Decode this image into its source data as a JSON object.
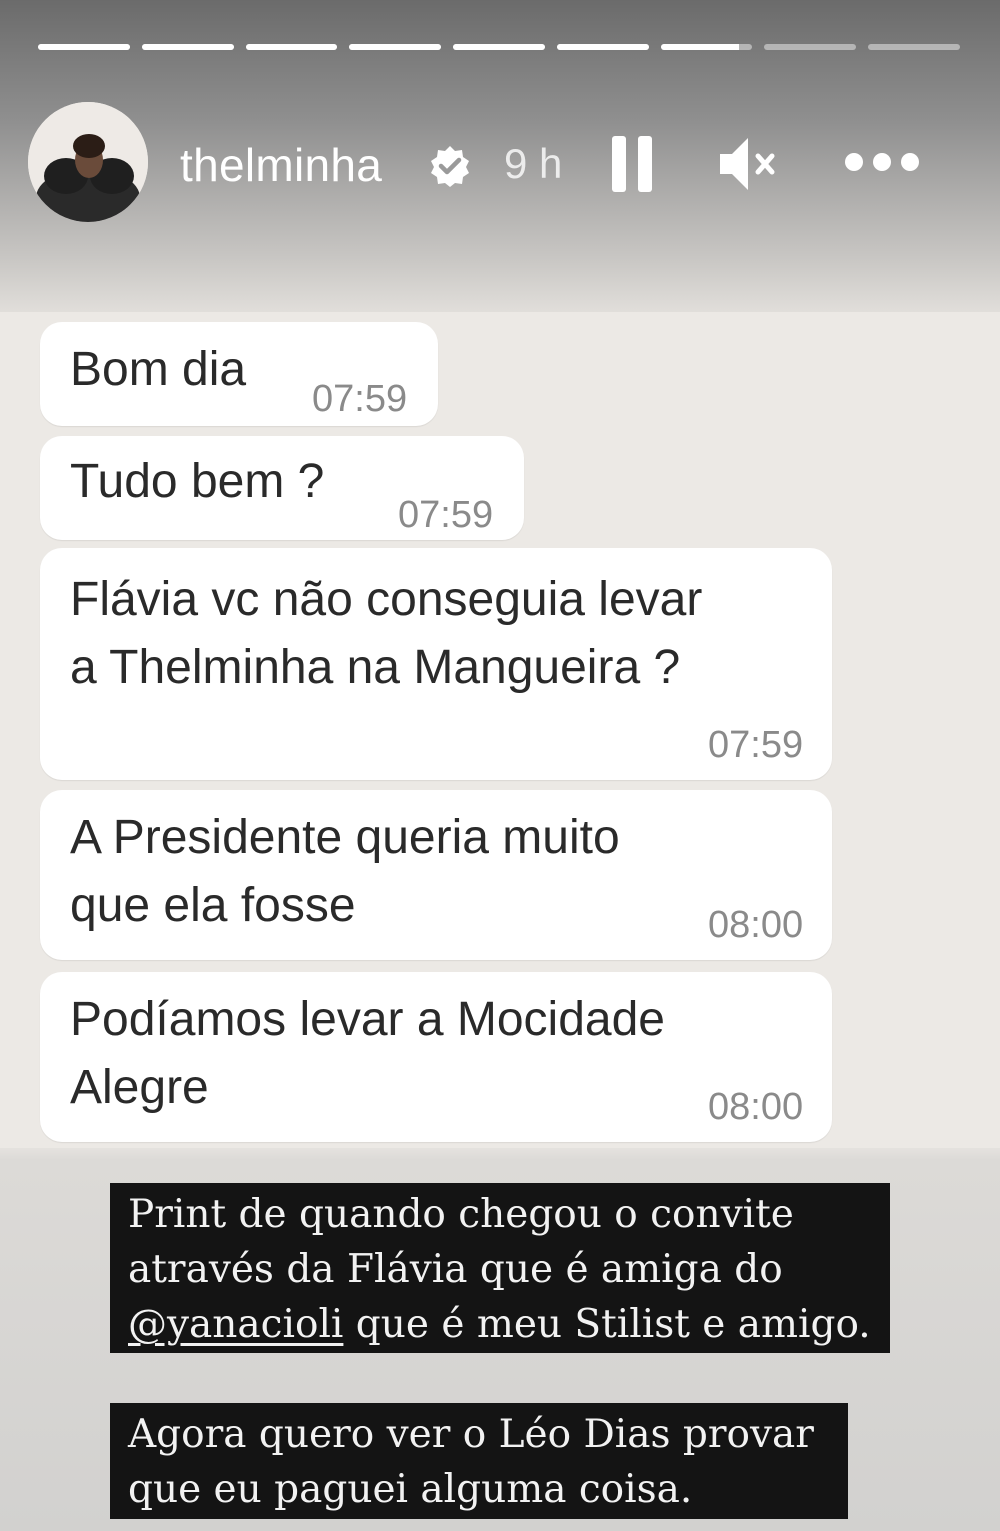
{
  "story": {
    "progress": [
      1,
      1,
      1,
      1,
      1,
      1,
      0.85,
      0,
      0
    ],
    "username": "thelminha",
    "verified": true,
    "time_ago": "9 h",
    "icons": {
      "pause": "pause-icon",
      "mute": "muted-speaker-icon",
      "more": "more-options-icon",
      "verified": "verified-badge-icon",
      "avatar": "profile-avatar"
    }
  },
  "chat": {
    "messages": [
      {
        "text": "Bom dia",
        "time": "07:59"
      },
      {
        "text": "Tudo bem ?",
        "time": "07:59"
      },
      {
        "text": "Flávia vc não conseguia levar\na Thelminha na Mangueira ?",
        "time": "07:59"
      },
      {
        "text": "A Presidente queria muito\nque ela fosse",
        "time": "08:00"
      },
      {
        "text": "Podíamos levar a Mocidade\nAlegre",
        "time": "08:00"
      }
    ]
  },
  "captions": {
    "first": {
      "line1": "Print de quando chegou o convite",
      "line2": "através da Flávia que é amiga do",
      "mention": "@yanacioli",
      "line3_rest": " que é meu Stilist e amigo."
    },
    "second": {
      "line1": "Agora quero ver o Léo Dias provar",
      "line2": "que eu paguei alguma coisa."
    }
  },
  "colors": {
    "bubble": "#ffffff",
    "chat_background": "#ece9e5",
    "caption_background": "#141414",
    "verified_badge": "#ffffff"
  }
}
